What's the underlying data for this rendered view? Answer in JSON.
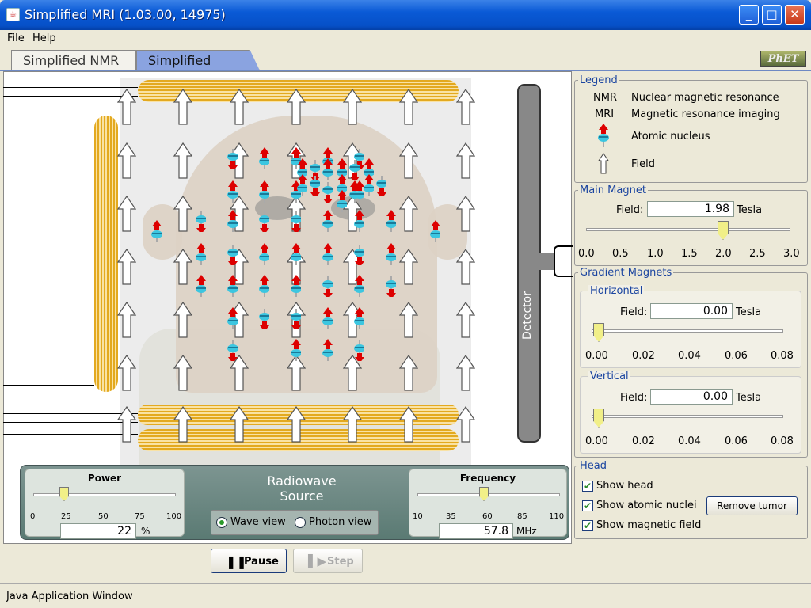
{
  "window": {
    "title": "Simplified MRI (1.03.00, 14975)",
    "app_icon": "java-icon"
  },
  "menu": {
    "items": [
      "File",
      "Help"
    ]
  },
  "tabs": [
    {
      "label": "Simplified NMR"
    },
    {
      "label": "Simplified MRI",
      "active": true
    }
  ],
  "logo": {
    "text": "PhET"
  },
  "detector": {
    "label": "Detector"
  },
  "rf_source": {
    "title_line1": "Radiowave",
    "title_line2": "Source",
    "power": {
      "label": "Power",
      "ticks": [
        "0",
        "25",
        "50",
        "75",
        "100"
      ],
      "value": "22",
      "unit": "%"
    },
    "frequency": {
      "label": "Frequency",
      "ticks": [
        "10",
        "35",
        "60",
        "85",
        "110"
      ],
      "value": "57.8",
      "unit": "MHz"
    },
    "views": [
      {
        "label": "Wave view",
        "selected": true
      },
      {
        "label": "Photon view",
        "selected": false
      }
    ]
  },
  "controls": {
    "pause": "Pause",
    "step": "Step"
  },
  "legend": {
    "title": "Legend",
    "items": [
      {
        "key": "NMR",
        "text": "Nuclear magnetic resonance"
      },
      {
        "key": "MRI",
        "text": "Magnetic resonance imaging"
      },
      {
        "icon": "atomic-nucleus-icon",
        "text": "Atomic nucleus"
      },
      {
        "icon": "field-arrow-icon",
        "text": "Field"
      }
    ]
  },
  "main_magnet": {
    "title": "Main Magnet",
    "field_label": "Field:",
    "value": "1.98",
    "unit": "Tesla",
    "ticks": [
      "0.0",
      "0.5",
      "1.0",
      "1.5",
      "2.0",
      "2.5",
      "3.0"
    ],
    "level": 1.98
  },
  "gradient": {
    "title": "Gradient Magnets",
    "horizontal": {
      "title": "Horizontal",
      "field_label": "Field:",
      "value": "0.00",
      "unit": "Tesla",
      "ticks": [
        "0.00",
        "0.02",
        "0.04",
        "0.06",
        "0.08"
      ]
    },
    "vertical": {
      "title": "Vertical",
      "field_label": "Field:",
      "value": "0.00",
      "unit": "Tesla",
      "ticks": [
        "0.00",
        "0.02",
        "0.04",
        "0.06",
        "0.08"
      ]
    }
  },
  "head_panel": {
    "title": "Head",
    "checkboxes": [
      {
        "label": "Show head",
        "checked": true
      },
      {
        "label": "Show atomic nuclei",
        "checked": true
      },
      {
        "label": "Show magnetic field",
        "checked": true
      }
    ],
    "remove_tumor": "Remove tumor"
  },
  "status": {
    "text": "Java Application Window"
  }
}
